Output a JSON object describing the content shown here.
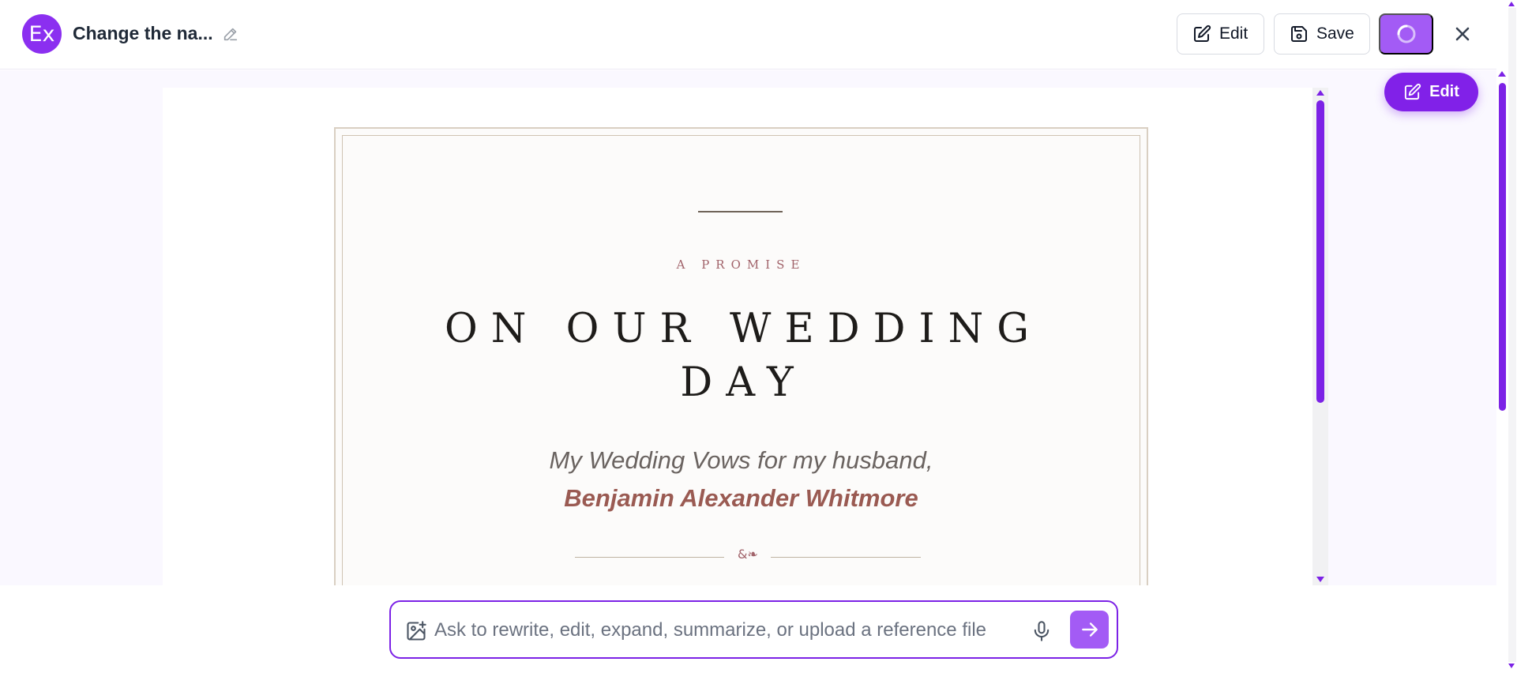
{
  "header": {
    "avatar_initials": "Ex",
    "doc_title": "Change the na...",
    "edit_label": "Edit",
    "save_label": "Save"
  },
  "floating_edit_label": "Edit",
  "document": {
    "kicker": "A PROMISE",
    "title": "ON OUR WEDDING DAY",
    "subtitle_line1": "My Wedding Vows for my husband,",
    "subtitle_line2": "Benjamin Alexander Whitmore",
    "ornament": "&❧"
  },
  "prompt": {
    "placeholder": "Ask to rewrite, edit, expand, summarize, or upload a reference file"
  },
  "colors": {
    "accent": "#7c22e6",
    "accent_light": "#a35bf5",
    "avatar": "#8b2ff0",
    "rose": "#9a5a52"
  },
  "icons": {
    "rename": "pencil-icon",
    "edit": "edit-square-icon",
    "save": "save-disk-icon",
    "loading": "spinner-icon",
    "close": "close-icon",
    "attach": "image-plus-icon",
    "mic": "microphone-icon",
    "send": "arrow-right-icon"
  }
}
